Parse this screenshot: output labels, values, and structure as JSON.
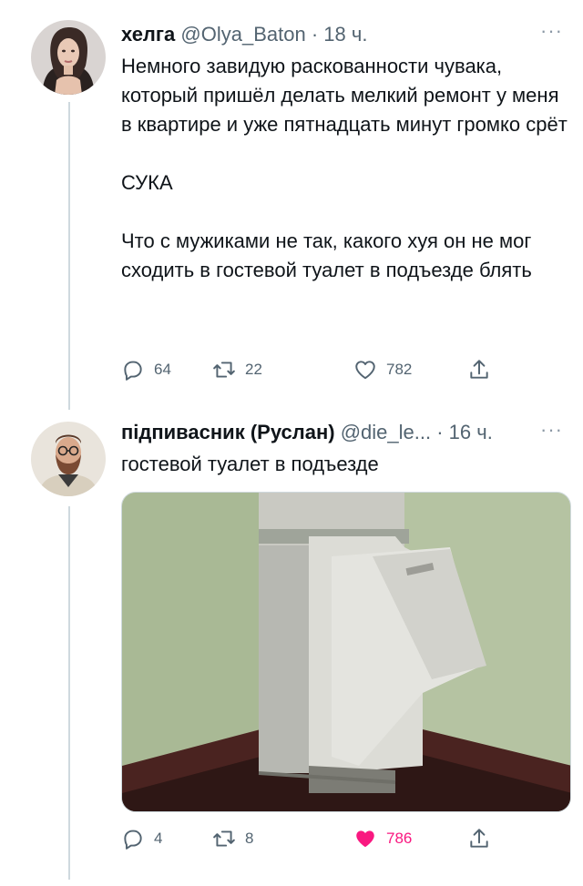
{
  "tweets": [
    {
      "display_name": "хелга",
      "handle": "@Olya_Baton",
      "separator": "·",
      "time": "18 ч.",
      "paragraphs": [
        "Немного завидую раскованности чувака, который пришёл делать мелкий ремонт у меня в квартире и уже пятнадцать минут громко срёт",
        "СУКА",
        "Что с мужиками не так, какого хуя он не мог сходить в гостевой туалет в подъезде блять"
      ],
      "replies": "64",
      "retweets": "22",
      "likes": "782"
    },
    {
      "display_name": "підпивасник (Руслан)",
      "handle": "@die_le...",
      "separator": "·",
      "time": "16 ч.",
      "paragraphs": [
        "гостевой туалет в подъезде"
      ],
      "replies": "4",
      "retweets": "8",
      "likes": "786",
      "liked": true
    }
  ],
  "more_label": "···",
  "colors": {
    "text": "#0f1419",
    "secondary": "#536471",
    "like_active": "#f91880",
    "thread_line": "#cfd9de"
  },
  "icons": [
    "reply-icon",
    "retweet-icon",
    "like-icon",
    "share-icon"
  ]
}
